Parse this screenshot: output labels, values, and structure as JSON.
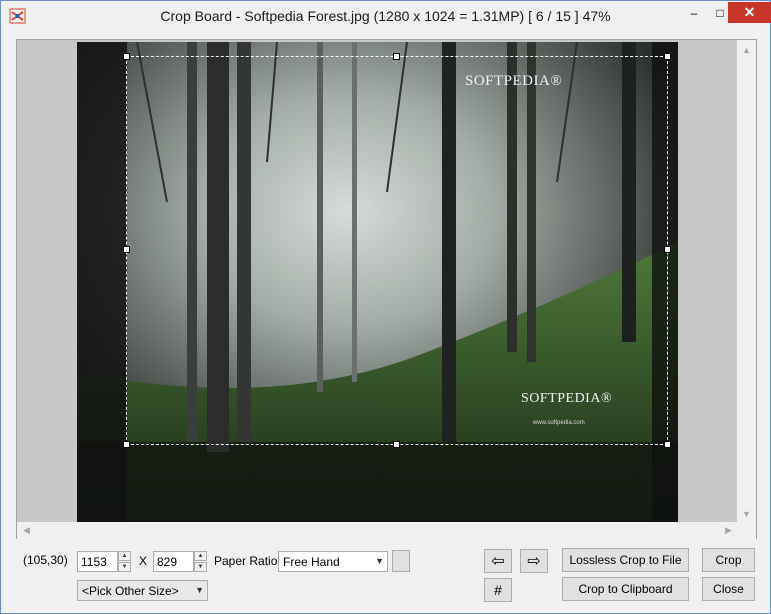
{
  "window": {
    "title": "Crop Board  -  Softpedia Forest.jpg  (1280 x 1024 = 1.31MP)  [ 6 / 15 ]   47%",
    "controls": {
      "minimize": "–",
      "maximize": "□",
      "close": "✕"
    }
  },
  "image": {
    "watermark_top": "SOFTPEDIA®",
    "watermark_bottom": "SOFTPEDIA®",
    "watermark_url": "www.softpedia.com"
  },
  "statusbar": {
    "coords": "(105,30)",
    "width_value": "1153",
    "x_label": "X",
    "height_value": "829",
    "paper_ratio_label": "Paper Ratio:",
    "paper_ratio_value": "Free Hand",
    "more_button": "...",
    "other_size_value": "<Pick Other Size>"
  },
  "buttons": {
    "prev_icon": "⇦",
    "next_icon": "⇨",
    "grid_icon": "#",
    "lossless_crop": "Lossless Crop to File",
    "crop_clipboard": "Crop to Clipboard",
    "crop": "Crop",
    "close": "Close"
  },
  "colors": {
    "close_button": "#c7352b",
    "accent_border": "#6b8fc7"
  }
}
